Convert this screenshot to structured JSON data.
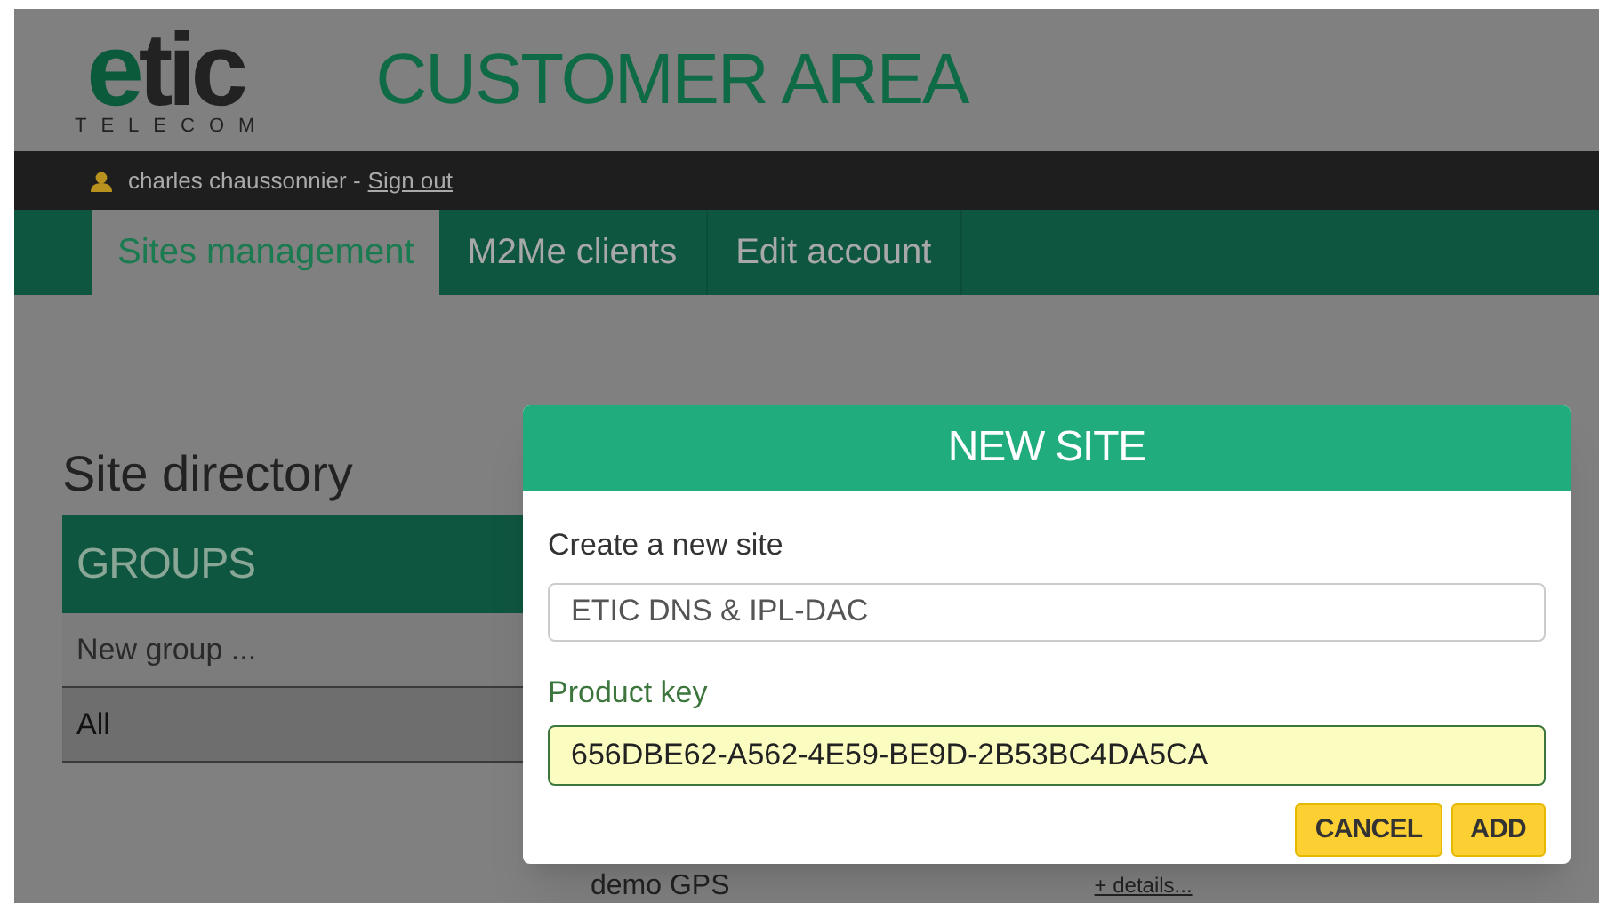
{
  "header": {
    "logo": {
      "wordmark": "etic",
      "tagline": "TELECOM"
    },
    "title": "CUSTOMER AREA"
  },
  "user_bar": {
    "user": "charles chaussonnier -",
    "sign_out": "Sign out"
  },
  "nav": {
    "tabs": [
      {
        "label": "Sites management",
        "selected": true
      },
      {
        "label": "M2Me clients",
        "selected": false
      },
      {
        "label": "Edit account",
        "selected": false
      }
    ]
  },
  "site_directory": {
    "title": "Site directory",
    "groups_header": "GROUPS",
    "groups": [
      {
        "label": "New group ...",
        "selected": false
      },
      {
        "label": "All",
        "selected": true
      }
    ],
    "site_row": {
      "name": "demo GPS",
      "link": "+ details..."
    }
  },
  "dialog": {
    "title": "NEW SITE",
    "name_label": "Create a new site",
    "name_value": "ETIC DNS & IPL-DAC",
    "key_label": "Product key",
    "key_value": "656DBE62-A562-4E59-BE9D-2B53BC4DA5CA",
    "buttons": [
      "CANCEL",
      "ADD"
    ]
  }
}
